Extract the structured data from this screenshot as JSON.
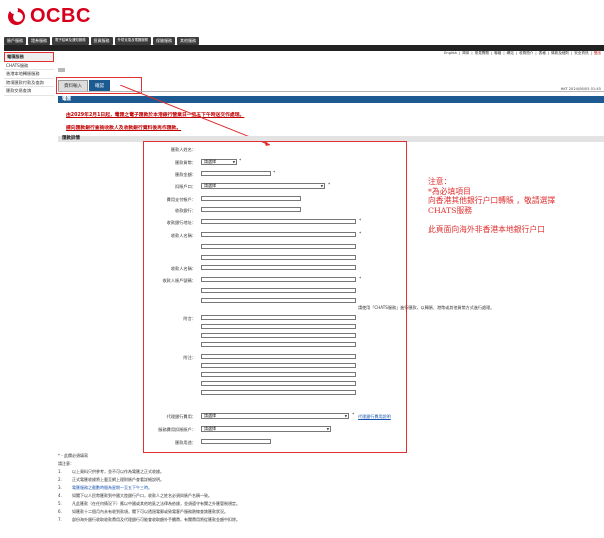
{
  "brand": {
    "name": "OCBC",
    "color": "#d6001c"
  },
  "nav": {
    "items": [
      "賬戶服務",
      "證券服務",
      "電子結單及通知服務",
      "投資服務",
      "外幣兌換及電匯服務",
      "保險服務",
      "其他服務"
    ]
  },
  "util_links": [
    "English",
    "简体",
    "常見問題",
    "聯絡",
    "網站",
    "收費簡介",
    "表格",
    "條款及細則",
    "安全資訊",
    "登出"
  ],
  "sidebar": {
    "items": [
      "電匯服務",
      "CHATS服務",
      "香港本地轉賬服務",
      "跨境匯款付款及查詢",
      "匯款交易查詢"
    ]
  },
  "tabs": [
    "資料輸入",
    "確認"
  ],
  "timestamp": "HKT 2024/08/05 01:45",
  "title_bar": "電匯",
  "notices": [
    "由2029年2月1日起，電匯之電子匯款於本港銀行營業日一至五下午時送交作處理。",
    "請向匯款銀行查詢收款人及收款銀行資料後再作匯款。"
  ],
  "section_title": "匯款詳情",
  "form": {
    "labels": {
      "payee_name": "匯款人姓名：",
      "currency": "匯款貨幣：",
      "amount": "匯款金額：",
      "debit_account": "扣賬戶口：",
      "fee_account": "費用支付帳戶：",
      "payee_bank": "收款銀行：",
      "payee_bank_address": "收款銀行地址：",
      "payee_name2": "收款人名稱：",
      "payee_account": "收款人賬戶號碼：",
      "remark": "附言：",
      "attach": "附注：",
      "agent_bank": "代理銀行費用：",
      "charge_account": "服務費用扣賬賬戶：",
      "purpose": "匯款用途："
    },
    "currency_value": "請選擇",
    "debit_value": "請選擇",
    "agent_value": "請選擇",
    "charge_value": "請選擇",
    "hint_chats": "請使用「CHATS服務」進行匯款，以轉賬、港幣或其他貨幣方式進行處理。",
    "agent_link": "代理銀行費用說明"
  },
  "annotation": {
    "lines": [
      "注意：",
      "*為必填項目",
      "向香港其他銀行户口轉賬 ，敬請選擇",
      "CHATS服務",
      "",
      "此頁面向海外非香港本地銀行户口"
    ]
  },
  "footer": {
    "heading": "* - 此欄必須填寫",
    "note": "請注意：",
    "items": [
      "以上資料只供參考，並不可以作為電匯之正式收據。",
      "正式電匯收據將上載至網上理財賬戶查看詳細說明。",
      "電匯服務之截數時間為星期一至五下午三時。",
      "如閣下以人民幣匯款到中國大陸銀行戶口，收款人之姓名必須與賬戶名稱一致。",
      "凡此匯款（在任何情況下）應以中國或其他地區之法律為依據，並須遵守有關之外匯管制規定。",
      "如匯款十二個月內未有收到款項，閣下可以透過電郵或致電客戶服務熱線查詢匯款狀況。",
      "部份海外銀行收取收款費用及代理銀行可能會收取額外手續費，有關費用將從匯款金額中扣除。"
    ]
  }
}
